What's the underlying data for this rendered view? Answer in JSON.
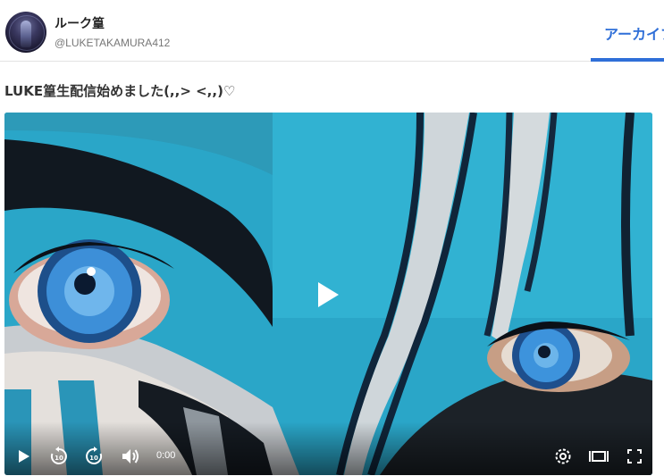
{
  "header": {
    "user_name": "ルーク篁",
    "user_handle": "@LUKETAKAMURA412",
    "active_tab": "アーカイブ"
  },
  "post": {
    "title": "LUKE篁生配信始めました(,,> <,,)♡"
  },
  "player": {
    "current_time": "0:00",
    "progress": 0,
    "colors": {
      "accent": "#2f6fd8",
      "paint_blue": "#2aa6c8"
    }
  }
}
